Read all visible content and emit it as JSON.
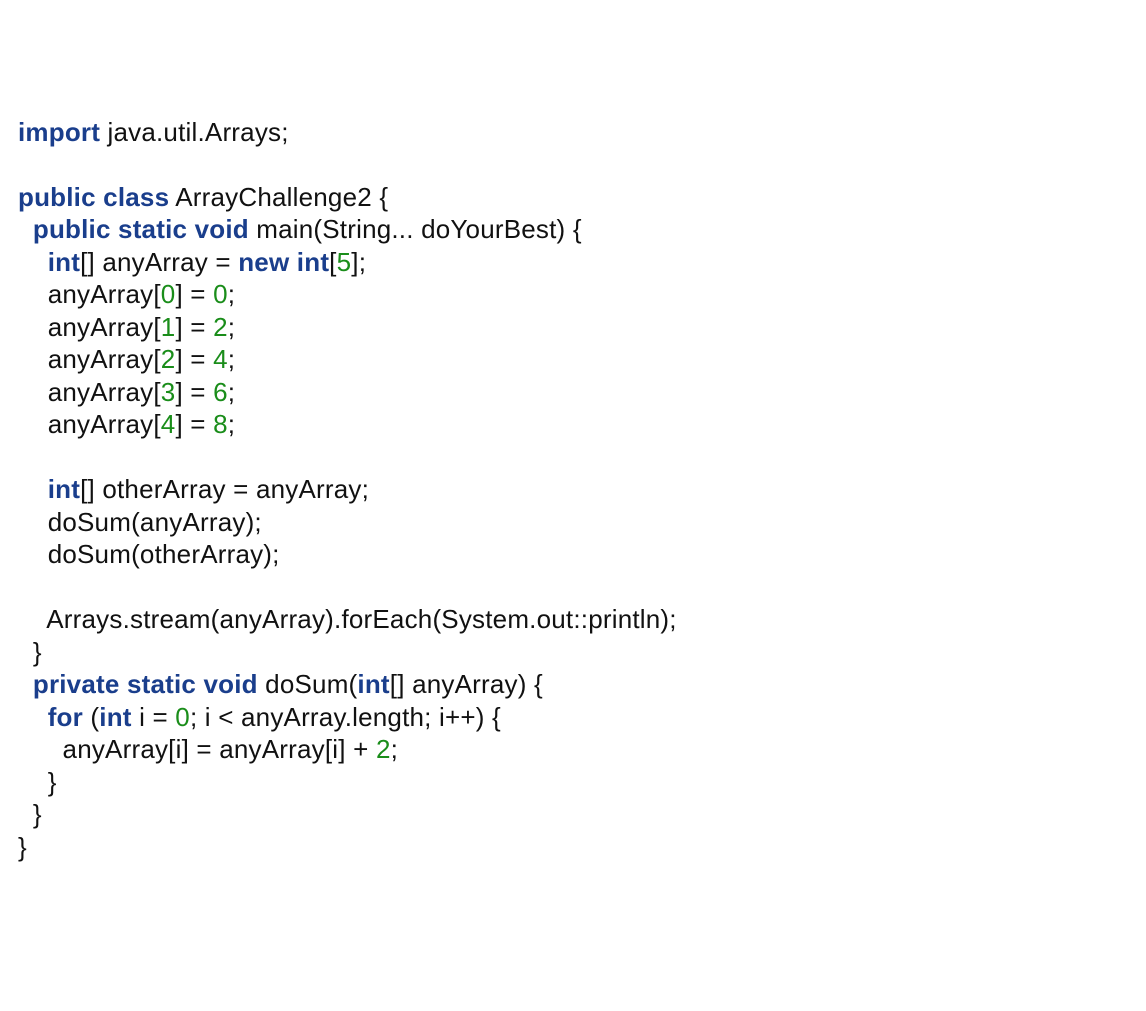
{
  "code": {
    "tokens": [
      [
        {
          "t": "import",
          "c": "kw"
        },
        {
          "t": " java.util.Arrays;",
          "c": "plain"
        }
      ],
      [
        {
          "t": "",
          "c": "plain"
        }
      ],
      [
        {
          "t": "public class",
          "c": "kw"
        },
        {
          "t": " ArrayChallenge2 {",
          "c": "plain"
        }
      ],
      [
        {
          "t": "  ",
          "c": "plain"
        },
        {
          "t": "public static void",
          "c": "kw"
        },
        {
          "t": " main(String... doYourBest) {",
          "c": "plain"
        }
      ],
      [
        {
          "t": "    ",
          "c": "plain"
        },
        {
          "t": "int",
          "c": "kw"
        },
        {
          "t": "[] anyArray = ",
          "c": "plain"
        },
        {
          "t": "new int",
          "c": "kw"
        },
        {
          "t": "[",
          "c": "plain"
        },
        {
          "t": "5",
          "c": "num"
        },
        {
          "t": "];",
          "c": "plain"
        }
      ],
      [
        {
          "t": "    anyArray[",
          "c": "plain"
        },
        {
          "t": "0",
          "c": "num"
        },
        {
          "t": "] = ",
          "c": "plain"
        },
        {
          "t": "0",
          "c": "num"
        },
        {
          "t": ";",
          "c": "plain"
        }
      ],
      [
        {
          "t": "    anyArray[",
          "c": "plain"
        },
        {
          "t": "1",
          "c": "num"
        },
        {
          "t": "] = ",
          "c": "plain"
        },
        {
          "t": "2",
          "c": "num"
        },
        {
          "t": ";",
          "c": "plain"
        }
      ],
      [
        {
          "t": "    anyArray[",
          "c": "plain"
        },
        {
          "t": "2",
          "c": "num"
        },
        {
          "t": "] = ",
          "c": "plain"
        },
        {
          "t": "4",
          "c": "num"
        },
        {
          "t": ";",
          "c": "plain"
        }
      ],
      [
        {
          "t": "    anyArray[",
          "c": "plain"
        },
        {
          "t": "3",
          "c": "num"
        },
        {
          "t": "] = ",
          "c": "plain"
        },
        {
          "t": "6",
          "c": "num"
        },
        {
          "t": ";",
          "c": "plain"
        }
      ],
      [
        {
          "t": "    anyArray[",
          "c": "plain"
        },
        {
          "t": "4",
          "c": "num"
        },
        {
          "t": "] = ",
          "c": "plain"
        },
        {
          "t": "8",
          "c": "num"
        },
        {
          "t": ";",
          "c": "plain"
        }
      ],
      [
        {
          "t": "",
          "c": "plain"
        }
      ],
      [
        {
          "t": "    ",
          "c": "plain"
        },
        {
          "t": "int",
          "c": "kw"
        },
        {
          "t": "[] otherArray = anyArray;",
          "c": "plain"
        }
      ],
      [
        {
          "t": "    doSum(anyArray);",
          "c": "plain"
        }
      ],
      [
        {
          "t": "    doSum(otherArray);",
          "c": "plain"
        }
      ],
      [
        {
          "t": "",
          "c": "plain"
        }
      ],
      [
        {
          "t": "    Arrays.stream(anyArray).forEach(System.out::println);",
          "c": "plain"
        }
      ],
      [
        {
          "t": "  }",
          "c": "plain"
        }
      ],
      [
        {
          "t": "  ",
          "c": "plain"
        },
        {
          "t": "private static void",
          "c": "kw"
        },
        {
          "t": " doSum(",
          "c": "plain"
        },
        {
          "t": "int",
          "c": "kw"
        },
        {
          "t": "[] anyArray) {",
          "c": "plain"
        }
      ],
      [
        {
          "t": "    ",
          "c": "plain"
        },
        {
          "t": "for",
          "c": "kw"
        },
        {
          "t": " (",
          "c": "plain"
        },
        {
          "t": "int",
          "c": "kw"
        },
        {
          "t": " i = ",
          "c": "plain"
        },
        {
          "t": "0",
          "c": "num"
        },
        {
          "t": "; i < anyArray.length; i++) {",
          "c": "plain"
        }
      ],
      [
        {
          "t": "      anyArray[i] = anyArray[i] + ",
          "c": "plain"
        },
        {
          "t": "2",
          "c": "num"
        },
        {
          "t": ";",
          "c": "plain"
        }
      ],
      [
        {
          "t": "    }",
          "c": "plain"
        }
      ],
      [
        {
          "t": "  }",
          "c": "plain"
        }
      ],
      [
        {
          "t": "}",
          "c": "plain"
        }
      ]
    ]
  }
}
